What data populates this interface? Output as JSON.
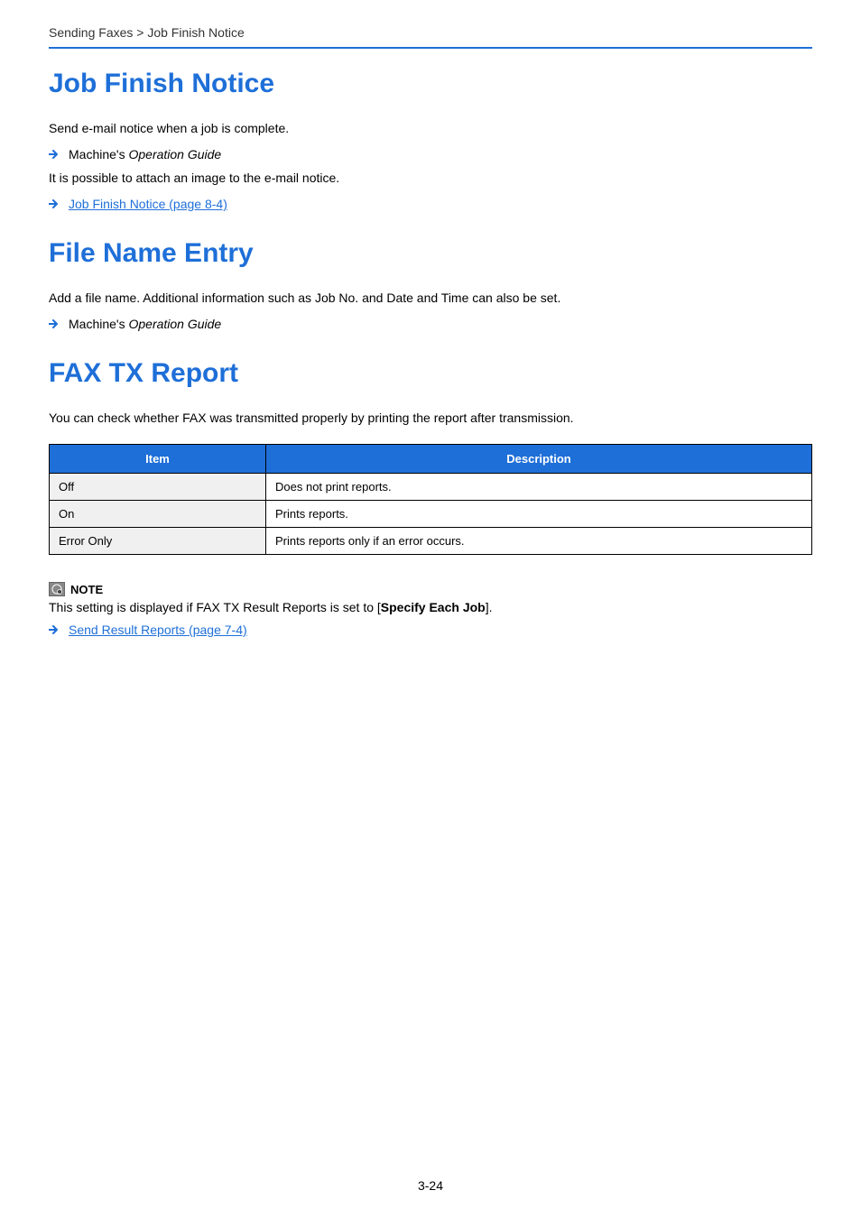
{
  "breadcrumb": "Sending Faxes > Job Finish Notice",
  "sections": {
    "jobFinish": {
      "title": "Job Finish Notice",
      "p1": "Send e-mail notice when a job is complete.",
      "refPrefix": "Machine's ",
      "refItalic": "Operation Guide",
      "p2": "It is possible to attach an image to the e-mail notice.",
      "link": "Job Finish Notice (page 8-4)"
    },
    "fileName": {
      "title": "File Name Entry",
      "p1": "Add a file name. Additional information such as Job No. and Date and Time can also be set.",
      "refPrefix": "Machine's ",
      "refItalic": "Operation Guide"
    },
    "faxTx": {
      "title": "FAX TX Report",
      "p1": "You can check whether FAX was transmitted properly by printing the report after transmission.",
      "table": {
        "headers": {
          "item": "Item",
          "description": "Description"
        },
        "rows": [
          {
            "item": "Off",
            "desc": "Does not print reports."
          },
          {
            "item": "On",
            "desc": "Prints reports."
          },
          {
            "item": "Error Only",
            "desc": "Prints reports only if an error occurs."
          }
        ]
      },
      "note": {
        "label": "NOTE",
        "textBefore": "This setting is displayed if FAX TX Result Reports is set to [",
        "textBold": "Specify Each Job",
        "textAfter": "].",
        "link": "Send Result Reports (page 7-4)"
      }
    }
  },
  "pageNumber": "3-24",
  "colors": {
    "accent": "#1e6fd8",
    "tableItemBg": "#f0f0f0"
  }
}
